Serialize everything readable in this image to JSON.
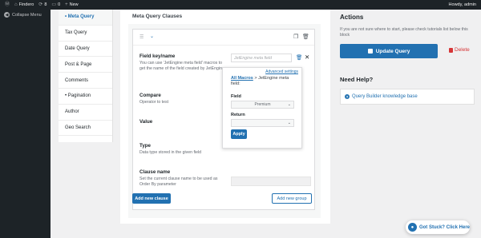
{
  "adminbar": {
    "site_name": "Findero",
    "updates_count": "8",
    "comments_count": "0",
    "new_label": "New",
    "greeting": "Howdy, admin"
  },
  "adminmenu": {
    "collapse_label": "Collapse Menu"
  },
  "tabs": [
    {
      "label": "• Meta Query",
      "active": true
    },
    {
      "label": "Tax Query"
    },
    {
      "label": "Date Query"
    },
    {
      "label": "Post & Page"
    },
    {
      "label": "Comments"
    },
    {
      "label": "• Pagination"
    },
    {
      "label": "Author"
    },
    {
      "label": "Geo Search"
    }
  ],
  "main": {
    "title": "Meta Query Clauses",
    "field_key_label": "Field key/name",
    "field_key_desc": "You can use 'JetEngine meta field' macros to get the name of the field created by JetEngine",
    "field_key_value": "JetEngine meta field",
    "compare_label": "Compare",
    "compare_desc": "Operator to test",
    "value_label": "Value",
    "type_label": "Type",
    "type_desc": "Data type stored in the given field",
    "clause_name_label": "Clause name",
    "clause_name_desc": "Set the current clause name to be used as Order By parameter",
    "add_clause": "Add new clause",
    "add_group": "Add new group"
  },
  "popover": {
    "advanced_settings": "Advanced settings",
    "all_macros": "All Macros",
    "macro_path": " > JetEngine meta field:",
    "field_label": "Field",
    "field_value": "Premium",
    "return_label": "Return",
    "return_value": "",
    "apply": "Apply"
  },
  "sidebar": {
    "actions_title": "Actions",
    "actions_desc": "If you are not sure where to start, please check tutorials list below this block",
    "update_label": "Update Query",
    "delete_label": "Delete",
    "help_title": "Need Help?",
    "kb_label": "Query Builder knowledge base"
  },
  "stuck": {
    "label": "Got Stuck? Click Here"
  },
  "icons": {
    "wp_logo": "wordpress-icon",
    "updates": "refresh-icon",
    "comments": "comment-icon",
    "new": "plus-icon"
  },
  "colors": {
    "accent": "#2271b1",
    "danger": "#d63638",
    "admin_dark": "#1d2327"
  }
}
